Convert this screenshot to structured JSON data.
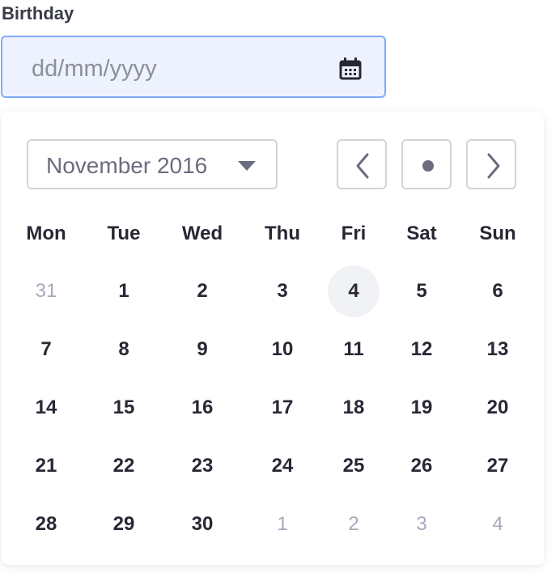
{
  "field": {
    "label": "Birthday",
    "placeholder": "dd/mm/yyyy",
    "value": ""
  },
  "calendar": {
    "month_label": "November 2016",
    "weekdays": [
      "Mon",
      "Tue",
      "Wed",
      "Thu",
      "Fri",
      "Sat",
      "Sun"
    ],
    "weeks": [
      [
        {
          "d": "31",
          "out": true
        },
        {
          "d": "1"
        },
        {
          "d": "2"
        },
        {
          "d": "3"
        },
        {
          "d": "4",
          "current": true
        },
        {
          "d": "5"
        },
        {
          "d": "6"
        }
      ],
      [
        {
          "d": "7"
        },
        {
          "d": "8"
        },
        {
          "d": "9"
        },
        {
          "d": "10"
        },
        {
          "d": "11"
        },
        {
          "d": "12"
        },
        {
          "d": "13"
        }
      ],
      [
        {
          "d": "14"
        },
        {
          "d": "15"
        },
        {
          "d": "16"
        },
        {
          "d": "17"
        },
        {
          "d": "18"
        },
        {
          "d": "19"
        },
        {
          "d": "20"
        }
      ],
      [
        {
          "d": "21"
        },
        {
          "d": "22"
        },
        {
          "d": "23"
        },
        {
          "d": "24"
        },
        {
          "d": "25"
        },
        {
          "d": "26"
        },
        {
          "d": "27"
        }
      ],
      [
        {
          "d": "28"
        },
        {
          "d": "29"
        },
        {
          "d": "30"
        },
        {
          "d": "1",
          "out": true
        },
        {
          "d": "2",
          "out": true
        },
        {
          "d": "3",
          "out": true
        },
        {
          "d": "4",
          "out": true
        }
      ]
    ]
  },
  "icons": {
    "calendar": "calendar-icon",
    "month_dropdown": "caret-down-icon",
    "previous": "chevron-left-icon",
    "today": "dot-icon",
    "next": "chevron-right-icon"
  },
  "colors": {
    "input_background": "#edf2fe",
    "input_border": "#80acff",
    "today_highlight": "#f1f2f5",
    "muted_text": "#a7a9bc"
  }
}
